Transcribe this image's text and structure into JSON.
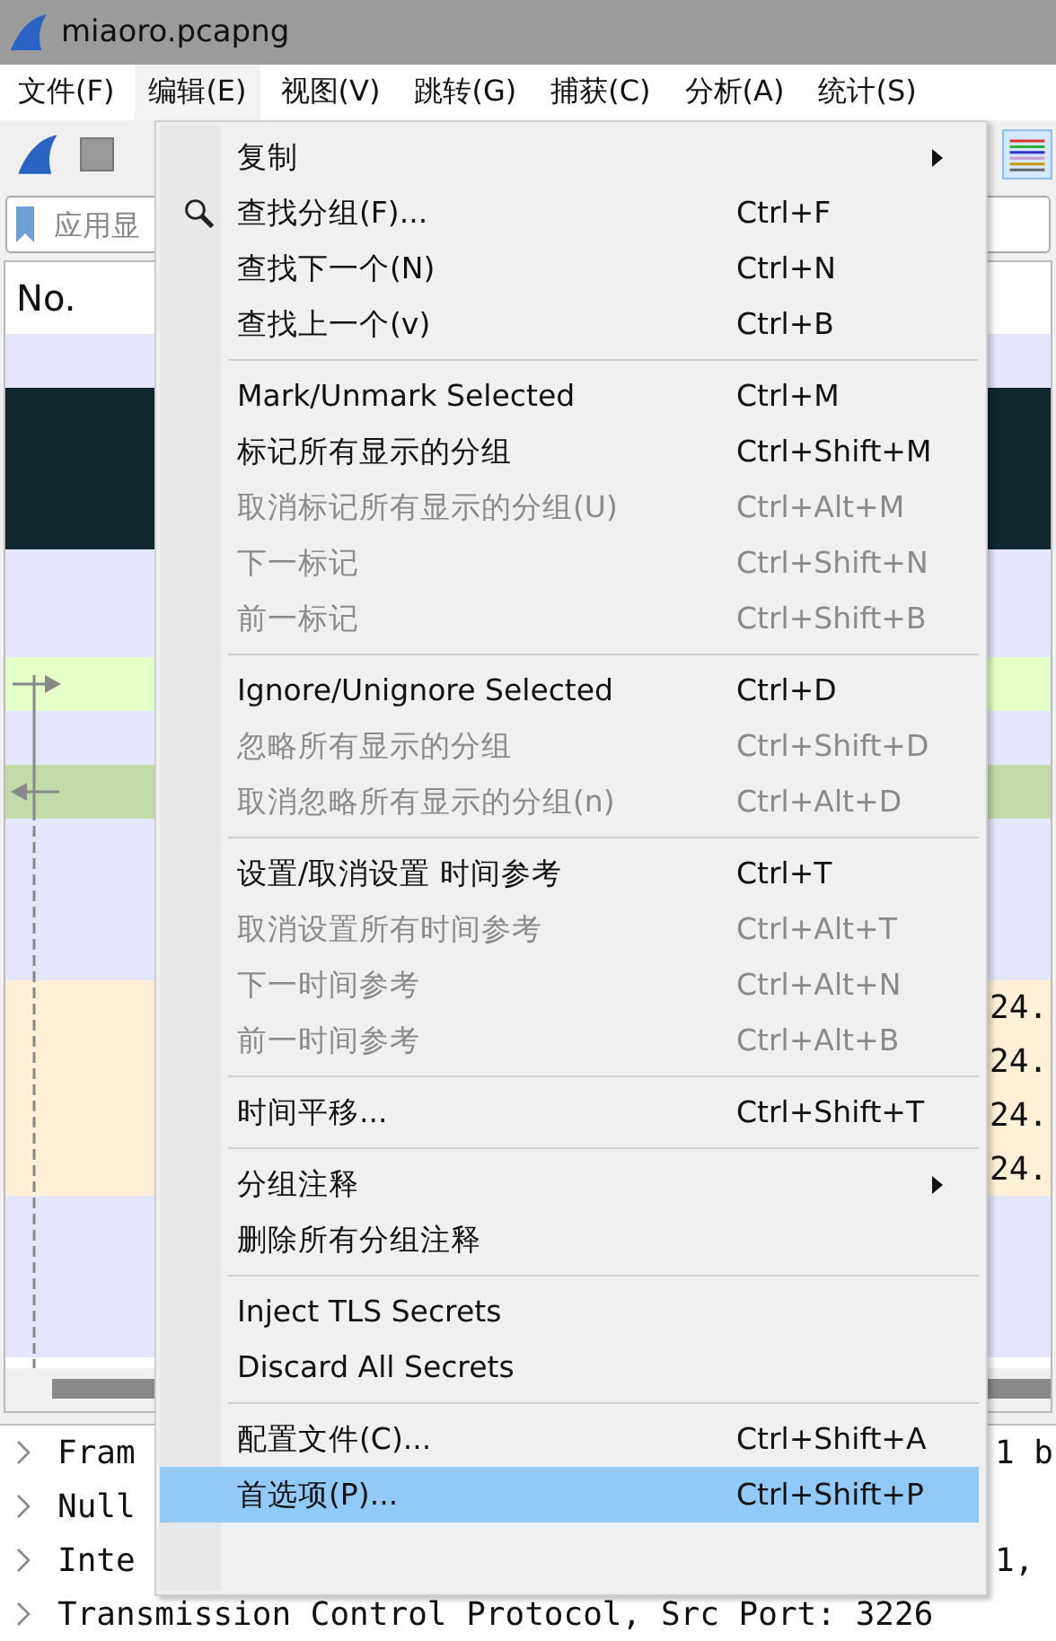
{
  "window": {
    "title": "miaoro.pcapng"
  },
  "menubar": [
    {
      "label": "文件(F)",
      "selected": false
    },
    {
      "label": "编辑(E)",
      "selected": true
    },
    {
      "label": "视图(V)",
      "selected": false
    },
    {
      "label": "跳转(G)",
      "selected": false
    },
    {
      "label": "捕获(C)",
      "selected": false
    },
    {
      "label": "分析(A)",
      "selected": false
    },
    {
      "label": "统计(S)",
      "selected": false
    }
  ],
  "filter": {
    "placeholder": "应用显"
  },
  "packet_list": {
    "column_1": "No.",
    "rows": [
      {
        "color": "#e6e6fb",
        "kind": "plain"
      },
      {
        "color": "#12272e",
        "kind": "plain"
      },
      {
        "color": "#12272e",
        "kind": "plain"
      },
      {
        "color": "#12272e",
        "kind": "plain"
      },
      {
        "color": "#e6e6fb",
        "kind": "plain"
      },
      {
        "color": "#e6e6fb",
        "kind": "plain"
      },
      {
        "color": "#e4ffc7",
        "kind": "request"
      },
      {
        "color": "#e6e6fb",
        "kind": "plain"
      },
      {
        "color": "#c3daa9",
        "kind": "response"
      },
      {
        "color": "#e6e6fb",
        "kind": "plain"
      },
      {
        "color": "#e6e6fb",
        "kind": "plain"
      },
      {
        "color": "#e6e6fb",
        "kind": "plain"
      },
      {
        "color": "#fdf0d5",
        "kind": "plain",
        "cell": "24."
      },
      {
        "color": "#fdf0d5",
        "kind": "plain",
        "cell": "24."
      },
      {
        "color": "#fdf0d5",
        "kind": "plain",
        "cell": "24."
      },
      {
        "color": "#fdf0d5",
        "kind": "plain",
        "cell": "24."
      },
      {
        "color": "#e6e6fb",
        "kind": "plain"
      },
      {
        "color": "#e6e6fb",
        "kind": "plain"
      },
      {
        "color": "#e6e6fb",
        "kind": "plain"
      }
    ]
  },
  "details": [
    {
      "text": "Fram",
      "tail": "1 b",
      "expanded": false
    },
    {
      "text": "Null",
      "expanded": false
    },
    {
      "text": "Inte",
      "tail": "1,",
      "expanded": false
    },
    {
      "text": "Transmission Control Protocol, Src Port: 3226",
      "expanded": false
    }
  ],
  "menu": [
    {
      "kind": "item",
      "label": "复制",
      "submenu": true,
      "disabled": false,
      "selected": false
    },
    {
      "kind": "item",
      "label": "查找分组(F)...",
      "shortcut": "Ctrl+F",
      "icon": true,
      "disabled": false,
      "selected": false
    },
    {
      "kind": "item",
      "label": "查找下一个(N)",
      "shortcut": "Ctrl+N",
      "disabled": false,
      "selected": false
    },
    {
      "kind": "item",
      "label": "查找上一个(v)",
      "shortcut": "Ctrl+B",
      "disabled": false,
      "selected": false
    },
    {
      "kind": "separator"
    },
    {
      "kind": "item",
      "label": "Mark/Unmark Selected",
      "shortcut": "Ctrl+M",
      "disabled": false,
      "selected": false
    },
    {
      "kind": "item",
      "label": "标记所有显示的分组",
      "shortcut": "Ctrl+Shift+M",
      "disabled": false,
      "selected": false
    },
    {
      "kind": "item",
      "label": "取消标记所有显示的分组(U)",
      "shortcut": "Ctrl+Alt+M",
      "disabled": true,
      "selected": false
    },
    {
      "kind": "item",
      "label": "下一标记",
      "shortcut": "Ctrl+Shift+N",
      "disabled": true,
      "selected": false
    },
    {
      "kind": "item",
      "label": "前一标记",
      "shortcut": "Ctrl+Shift+B",
      "disabled": true,
      "selected": false
    },
    {
      "kind": "separator"
    },
    {
      "kind": "item",
      "label": "Ignore/Unignore Selected",
      "shortcut": "Ctrl+D",
      "disabled": false,
      "selected": false
    },
    {
      "kind": "item",
      "label": "忽略所有显示的分组",
      "shortcut": "Ctrl+Shift+D",
      "disabled": true,
      "selected": false
    },
    {
      "kind": "item",
      "label": "取消忽略所有显示的分组(n)",
      "shortcut": "Ctrl+Alt+D",
      "disabled": true,
      "selected": false
    },
    {
      "kind": "separator"
    },
    {
      "kind": "item",
      "label": "设置/取消设置 时间参考",
      "shortcut": "Ctrl+T",
      "disabled": false,
      "selected": false
    },
    {
      "kind": "item",
      "label": "取消设置所有时间参考",
      "shortcut": "Ctrl+Alt+T",
      "disabled": true,
      "selected": false
    },
    {
      "kind": "item",
      "label": "下一时间参考",
      "shortcut": "Ctrl+Alt+N",
      "disabled": true,
      "selected": false
    },
    {
      "kind": "item",
      "label": "前一时间参考",
      "shortcut": "Ctrl+Alt+B",
      "disabled": true,
      "selected": false
    },
    {
      "kind": "separator"
    },
    {
      "kind": "item",
      "label": "时间平移...",
      "shortcut": "Ctrl+Shift+T",
      "disabled": false,
      "selected": false
    },
    {
      "kind": "separator"
    },
    {
      "kind": "item",
      "label": "分组注释",
      "submenu": true,
      "disabled": false,
      "selected": false
    },
    {
      "kind": "item",
      "label": "删除所有分组注释",
      "disabled": false,
      "selected": false
    },
    {
      "kind": "separator"
    },
    {
      "kind": "item",
      "label": "Inject TLS Secrets",
      "disabled": false,
      "selected": false
    },
    {
      "kind": "item",
      "label": "Discard All Secrets",
      "disabled": false,
      "selected": false
    },
    {
      "kind": "separator"
    },
    {
      "kind": "item",
      "label": "配置文件(C)...",
      "shortcut": "Ctrl+Shift+A",
      "disabled": false,
      "selected": false
    },
    {
      "kind": "item",
      "label": "首选项(P)...",
      "shortcut": "Ctrl+Shift+P",
      "disabled": false,
      "selected": true
    }
  ]
}
